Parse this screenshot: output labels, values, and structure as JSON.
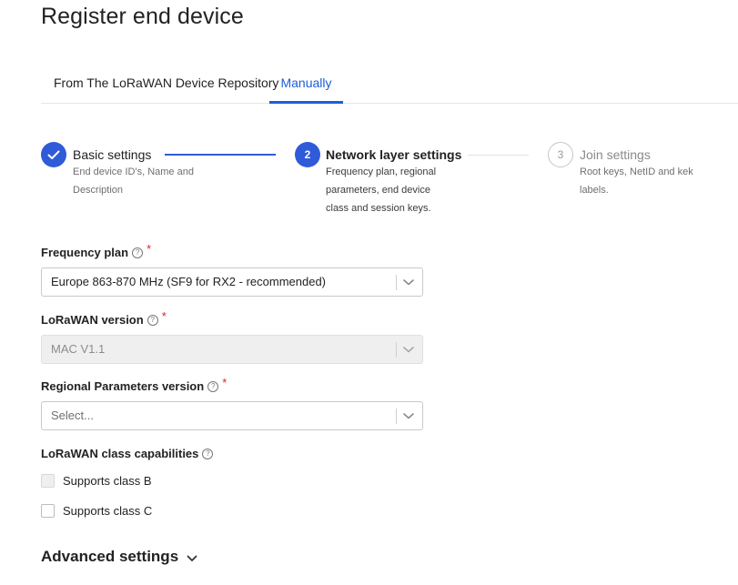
{
  "page": {
    "title": "Register end device"
  },
  "tabs": [
    {
      "label": "From The LoRaWAN Device Repository"
    },
    {
      "label": "Manually",
      "active": true
    }
  ],
  "steps": [
    {
      "number": "1",
      "title": "Basic settings",
      "description": "End device ID's, Name and Description",
      "status": "completed"
    },
    {
      "number": "2",
      "title": "Network layer settings",
      "description": "Frequency plan, regional parameters, end device class and session keys.",
      "status": "active"
    },
    {
      "number": "3",
      "title": "Join settings",
      "description": "Root keys, NetID and kek labels.",
      "status": "pending"
    }
  ],
  "form": {
    "frequency_plan": {
      "label": "Frequency plan",
      "value": "Europe 863-870 MHz (SF9 for RX2 - recommended)",
      "required": "*"
    },
    "lorawan_version": {
      "label": "LoRaWAN version",
      "value": "MAC V1.1",
      "required": "*"
    },
    "regional_parameters": {
      "label": "Regional Parameters version",
      "placeholder": "Select...",
      "required": "*"
    },
    "class_capabilities": {
      "label": "LoRaWAN class capabilities",
      "class_b": "Supports class B",
      "class_c": "Supports class C"
    }
  },
  "advanced": {
    "label": "Advanced settings"
  },
  "icons": {
    "help": "?",
    "checkmark": "check-icon",
    "chevron": "chevron-down-icon"
  },
  "colors": {
    "accent": "#2f5bd9",
    "tab_active": "#1c5ed8",
    "required": "#d9232f"
  }
}
